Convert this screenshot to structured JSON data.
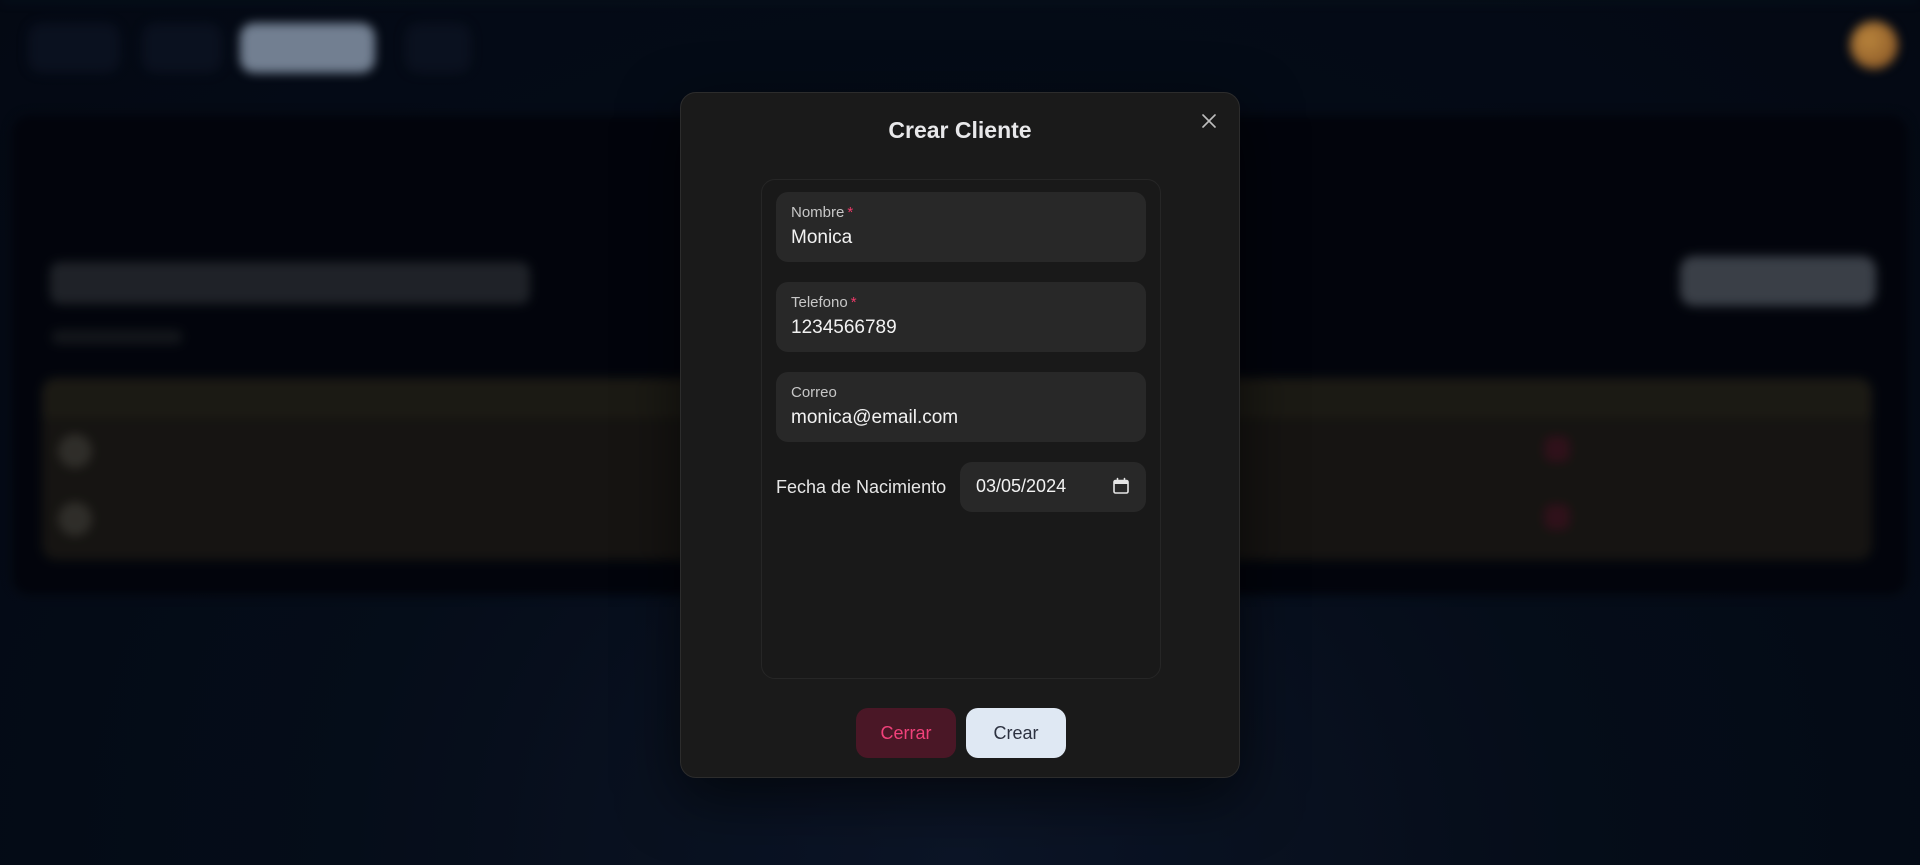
{
  "background": {
    "nav_items": [
      "",
      "",
      "",
      ""
    ],
    "page_title": "",
    "add_button": "",
    "table_headers": [
      "",
      ""
    ],
    "rows": [
      {
        "name": "",
        "email": ""
      },
      {
        "name": "",
        "email": ""
      }
    ]
  },
  "modal": {
    "title": "Crear Cliente",
    "close_icon": "close-icon",
    "fields": [
      {
        "label": "Nombre",
        "required_mark": "*",
        "value": "Monica"
      },
      {
        "label": "Telefono",
        "required_mark": "*",
        "value": "1234566789"
      },
      {
        "label": "Correo",
        "required_mark": "",
        "value": "monica@email.com"
      }
    ],
    "date_field": {
      "label": "Fecha de Nacimiento",
      "value": "03/05/2024",
      "icon": "calendar-icon"
    },
    "buttons": {
      "cancel_label": "Cerrar",
      "submit_label": "Crear"
    }
  },
  "colors": {
    "modal_bg": "#1a1a1a",
    "field_bg": "#282828",
    "required": "#f03a6a",
    "cancel_bg": "#4a1726",
    "cancel_text": "#f0417a",
    "submit_bg": "#dfe8f3"
  }
}
